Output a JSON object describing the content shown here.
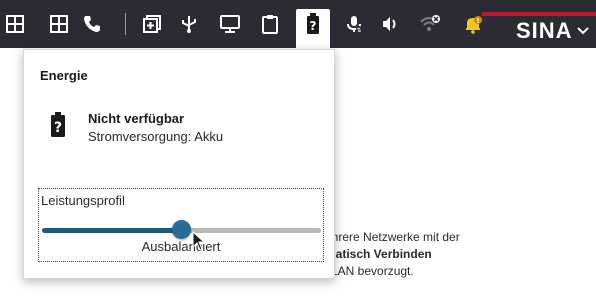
{
  "taskbar": {
    "icons": [
      "grid-icon",
      "grid-icon",
      "phone-icon",
      "add-window-icon",
      "usb-icon",
      "monitor-icon",
      "clipboard-icon",
      "battery-unknown-icon",
      "microphone-icon",
      "speaker-icon",
      "wifi-disconnected-icon",
      "notification-bell-icon"
    ],
    "active_icon": "battery-unknown-icon",
    "brand": "SINA",
    "brand_accent_color": "#c01a2c"
  },
  "background": {
    "line1": "ehrere Netzwerke mit der",
    "line2": "matisch Verbinden",
    "line3": "l LAN bevorzugt."
  },
  "popup": {
    "title": "Energie",
    "status_title": "Nicht verfügbar",
    "status_sub": "Stromversorgung: Akku",
    "profile_label": "Leistungsprofil",
    "profile_value": "Ausbalanciert",
    "slider_fraction": 0.5,
    "accent_color": "#1e5b7e"
  }
}
